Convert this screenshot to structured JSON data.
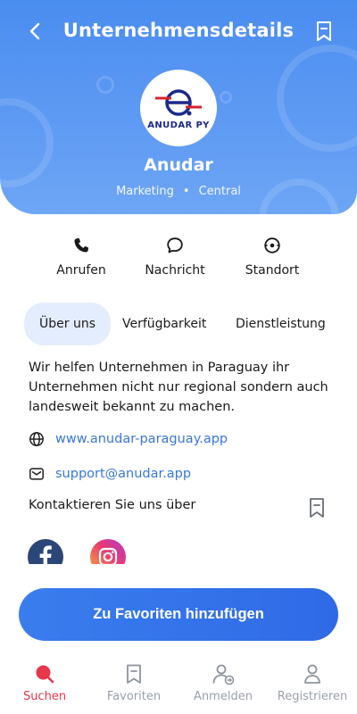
{
  "header": {
    "title": "Unternehmensdetails",
    "logo_text": "ANUDAR PY",
    "company_name": "Anudar",
    "category": "Marketing",
    "location": "Central",
    "meta_separator": "•"
  },
  "actions": [
    {
      "label": "Anrufen",
      "icon": "phone-icon"
    },
    {
      "label": "Nachricht",
      "icon": "chat-icon"
    },
    {
      "label": "Standort",
      "icon": "location-icon"
    }
  ],
  "tabs": [
    {
      "label": "Über uns",
      "active": true
    },
    {
      "label": "Verfügbarkeit",
      "active": false
    },
    {
      "label": "Dienstleistung",
      "active": false
    }
  ],
  "about": {
    "description": "Wir helfen Unternehmen in Paraguay ihr Unternehmen nicht nur regional sondern auch landesweit bekannt zu machen.",
    "website": "www.anudar-paraguay.app",
    "email": "support@anudar.app",
    "contact_title": "Kontaktieren Sie uns über"
  },
  "socials": [
    "facebook-icon",
    "instagram-icon"
  ],
  "favorite_button": "Zu Favoriten hinzufügen",
  "bottom_nav": [
    {
      "label": "Suchen",
      "icon": "search-icon",
      "active": true
    },
    {
      "label": "Favoriten",
      "icon": "bookmark-icon",
      "active": false
    },
    {
      "label": "Anmelden",
      "icon": "login-user-icon",
      "active": false
    },
    {
      "label": "Registrieren",
      "icon": "user-icon",
      "active": false
    }
  ],
  "colors": {
    "primary": "#4a8df0",
    "button": "#2f6ae6",
    "link": "#3a76dd",
    "active_nav": "#e8364b",
    "tab_active_bg": "#e4edfd"
  }
}
